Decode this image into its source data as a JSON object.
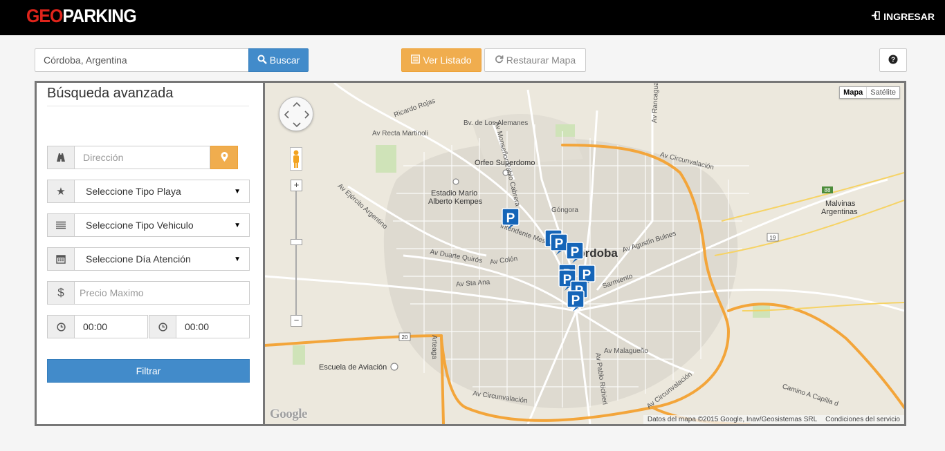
{
  "brand": {
    "part1": "GEO",
    "part2": "PARKING"
  },
  "nav": {
    "login_label": "INGRESAR"
  },
  "toolbar": {
    "search_value": "Córdoba, Argentina",
    "search_button": "Buscar",
    "list_button": "Ver Listado",
    "reset_button": "Restaurar Mapa"
  },
  "sidebar": {
    "title": "Búsqueda avanzada",
    "address_placeholder": "Dirección",
    "tipo_playa": "Seleccione Tipo Playa",
    "tipo_vehiculo": "Seleccione Tipo Vehiculo",
    "dia_atencion": "Seleccione Día Atención",
    "precio_placeholder": "Precio Maximo",
    "hora_desde": "00:00",
    "hora_hasta": "00:00",
    "filter_button": "Filtrar"
  },
  "map": {
    "type_map": "Mapa",
    "type_satellite": "Satélite",
    "google_logo": "Google",
    "attribution": "Datos del mapa ©2015 Google, Inav/Geosistemas SRL",
    "terms": "Condiciones del servicio",
    "city_label": "Córdoba",
    "labels": {
      "orfeo": "Orfeo Superdomo",
      "estadio_1": "Estadio Mario",
      "estadio_2": "Alberto Kempes",
      "malvinas_1": "Malvinas",
      "malvinas_2": "Argentinas",
      "escuela": "Escuela de Aviación",
      "gongora": "Góngora",
      "av_circ_1": "Av Circunvalación",
      "av_circ_2": "Av Circunvalación",
      "av_circ_3": "Av Circunvalación",
      "ricardo_rojas": "Ricardo Rojas",
      "recta_martinoli": "Av Recta Martinoli",
      "alemanes": "Bv. de Los Alemanes",
      "monsenor": "Av Monseñor Pablo Cabrera",
      "ejercito": "Av Ejército Argentino",
      "duarte": "Av Duarte Quirós",
      "colon": "Av Colón",
      "sta_ana": "Av Sta Ana",
      "sarmiento": "Sarmiento",
      "bulnes": "Av Agustín Bulnes",
      "malagueno": "Av Malagueño",
      "pablo_richieri": "Av Pablo Richieri",
      "rancagua": "Av Rancagua",
      "intendente": "Intendente Mestre",
      "arteaga": "Arteaga",
      "capilla": "Camino A Capilla d",
      "route_88": "88",
      "route_19": "19",
      "route_20": "20"
    }
  },
  "colors": {
    "navbar": "#000000",
    "brand_red": "#e0241b",
    "primary": "#428bca",
    "warning": "#f0ad4e",
    "marker": "#1565b8",
    "highway": "#f3a53a"
  }
}
